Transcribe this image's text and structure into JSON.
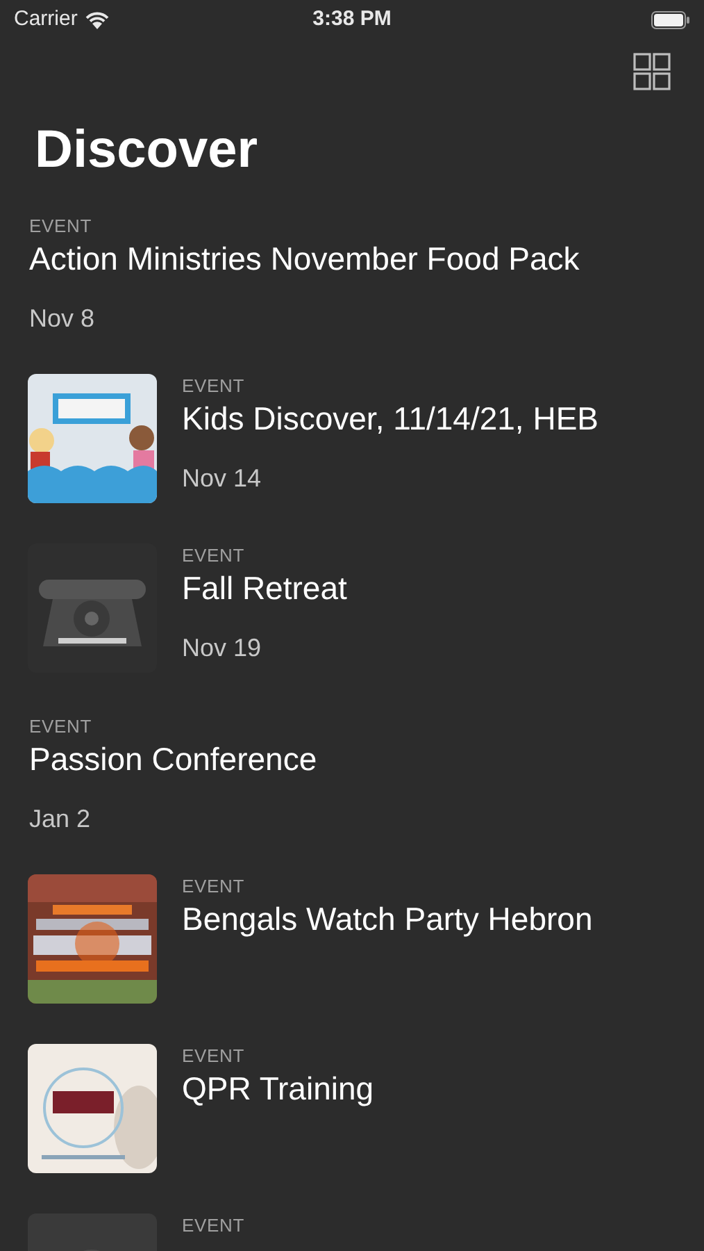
{
  "status_bar": {
    "carrier": "Carrier",
    "time": "3:38 PM"
  },
  "title": "Discover",
  "items": [
    {
      "kind": "plain",
      "label": "EVENT",
      "title": "Action Ministries November Food Pack",
      "date": "Nov 8"
    },
    {
      "label": "EVENT",
      "title": "Kids Discover, 11/14/21, HEB",
      "date": "Nov 14"
    },
    {
      "label": "EVENT",
      "title": "Fall Retreat",
      "date": "Nov 19"
    },
    {
      "kind": "plain",
      "label": "EVENT",
      "title": "Passion Conference",
      "date": "Jan 2"
    },
    {
      "label": "EVENT",
      "title": "Bengals Watch Party Hebron"
    },
    {
      "label": "EVENT",
      "title": "QPR Training"
    },
    {
      "label": "EVENT"
    }
  ]
}
